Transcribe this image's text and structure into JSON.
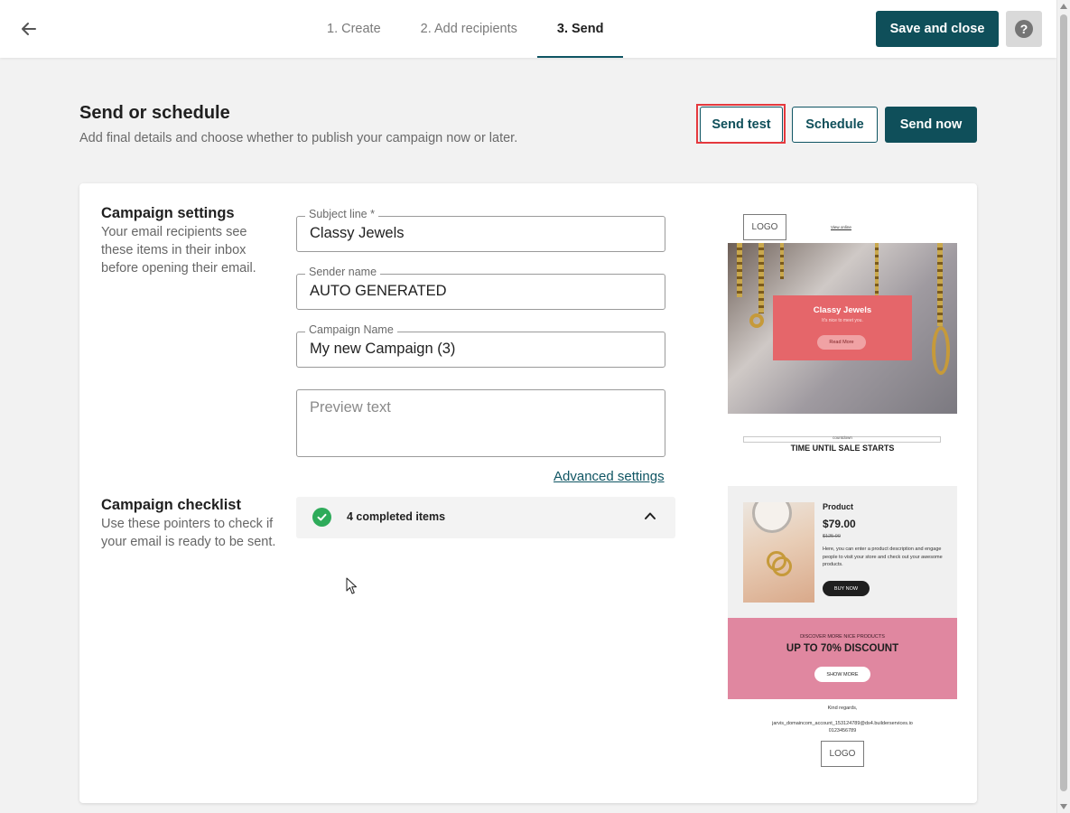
{
  "steps": [
    "1. Create",
    "2. Add recipients",
    "3. Send"
  ],
  "active_step": "3. Send",
  "header": {
    "save_close_label": "Save and close",
    "help_label": "?"
  },
  "page": {
    "title": "Send or schedule",
    "subtitle": "Add final details and choose whether to publish your campaign now or later."
  },
  "actions": {
    "send_test": "Send test",
    "schedule": "Schedule",
    "send_now": "Send now"
  },
  "campaign_settings": {
    "title": "Campaign settings",
    "description": "Your email recipients see these items in their inbox before opening their email.",
    "subject_label": "Subject line *",
    "subject_value": "Classy Jewels",
    "sender_label": "Sender name",
    "sender_value": "AUTO GENERATED",
    "campaign_name_label": "Campaign Name",
    "campaign_name_value": "My new Campaign (3)",
    "preview_placeholder": "Preview text",
    "advanced_link": "Advanced settings"
  },
  "checklist": {
    "title": "Campaign checklist",
    "description": "Use these pointers to check if your email is ready to be sent.",
    "summary": "4 completed items"
  },
  "email_preview": {
    "logo": "LOGO",
    "view_online": "View online",
    "hero_title": "Classy Jewels",
    "hero_subtitle": "It's nice to meet you.",
    "read_more": "Read More",
    "countdown_label": "countdown",
    "countdown_title": "TIME UNTIL SALE STARTS",
    "product_name": "Product",
    "product_price": "$79.00",
    "product_old_price": "$125.00",
    "product_desc": "Here, you can enter a product description and engage people to visit your store and check out your awesome products.",
    "buy_now": "BUY NOW",
    "discover": "DISCOVER MORE NICE PRODUCTS",
    "discount": "UP TO 70% DISCOUNT",
    "show_more": "SHOW MORE",
    "regards": "Kind regards,",
    "email": "jarvis_domaincom_account_153124789@ds4.builderservices.io",
    "phone": "0123456789",
    "footer_logo": "LOGO"
  },
  "colors": {
    "primary": "#0f4f5a",
    "highlight": "#e5393e",
    "success": "#2eab5a",
    "hero_box": "#e5666a",
    "discount_bg": "#e087a0"
  },
  "icons": [
    "arrow-left-icon",
    "question-icon",
    "check-circle-icon",
    "chevron-up-icon",
    "mouse-cursor-icon"
  ]
}
